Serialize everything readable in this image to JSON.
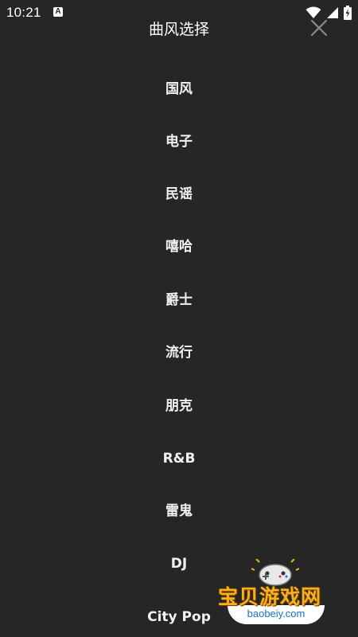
{
  "status_bar": {
    "time": "10:21",
    "notification_icon_letter": "A",
    "icons": [
      "wifi-icon",
      "signal-icon",
      "battery-charging-icon"
    ]
  },
  "header": {
    "title": "曲风选择",
    "close_icon": "close-icon"
  },
  "genres": [
    "国风",
    "电子",
    "民谣",
    "嘻哈",
    "爵士",
    "流行",
    "朋克",
    "R&B",
    "雷鬼",
    "DJ",
    "City Pop"
  ],
  "watermark": {
    "title": "宝贝游戏网",
    "url": "baobeiy.com"
  },
  "colors": {
    "background": "#262626",
    "text": "#ffffff",
    "watermark_orange": "#f6b21a",
    "watermark_blue": "#1a6fc4"
  }
}
